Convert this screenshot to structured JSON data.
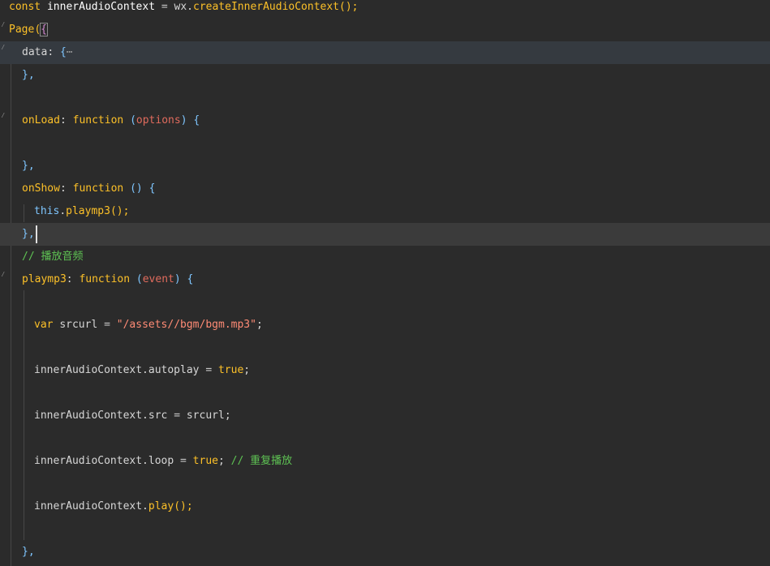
{
  "editor": {
    "language": "javascript",
    "lines": {
      "l1": {
        "kw": "const",
        "name": "innerAudioContext",
        "eq": "=",
        "obj": "wx.",
        "fn": "createInnerAudioContext",
        "tail": "();"
      },
      "l2": {
        "fn": "Page",
        "open": "(",
        "brace": "{"
      },
      "l3": {
        "key": "data",
        "colon": ":",
        "brace": "{",
        "ellipsis": "⋯"
      },
      "l4": {
        "text": "},"
      },
      "l6": {
        "key": "onLoad",
        "colon": ":",
        "kw": "function",
        "po": "(",
        "param": "options",
        "pc": ")",
        "brace": "{"
      },
      "l8": {
        "text": "},"
      },
      "l9": {
        "key": "onShow",
        "colon": ":",
        "kw": "function",
        "parens": "()",
        "brace": "{"
      },
      "l10": {
        "this": "this",
        "dot": ".",
        "fn": "playmp3",
        "tail": "();"
      },
      "l11": {
        "text": "},"
      },
      "l12": {
        "comment": "// 播放音频"
      },
      "l13": {
        "key": "playmp3",
        "colon": ":",
        "kw": "function",
        "po": "(",
        "param": "event",
        "pc": ")",
        "brace": "{"
      },
      "l15": {
        "kw": "var",
        "name": "srcurl",
        "eq": "=",
        "str": "\"/assets//bgm/bgm.mp3\"",
        "semi": ";"
      },
      "l17": {
        "obj": "innerAudioContext.autoplay",
        "eq": "=",
        "bool": "true",
        "semi": ";"
      },
      "l19": {
        "obj": "innerAudioContext.src",
        "eq": "=",
        "name": "srcurl",
        "semi": ";"
      },
      "l21": {
        "obj": "innerAudioContext.loop",
        "eq": "=",
        "bool": "true",
        "semi": ";",
        "comment": "// 重复播放"
      },
      "l23": {
        "obj": "innerAudioContext.",
        "fn": "play",
        "tail": "();"
      },
      "l25": {
        "text": "},"
      }
    },
    "colors": {
      "background": "#2b2b2b",
      "keyword": "#fcc028",
      "string": "#ff8b75",
      "comment": "#5ec253",
      "this": "#7fc6ff",
      "param": "#e06b5d",
      "text": "#d6d6d6"
    },
    "icons": {
      "fold_marker": "fold-marker-icon"
    }
  }
}
